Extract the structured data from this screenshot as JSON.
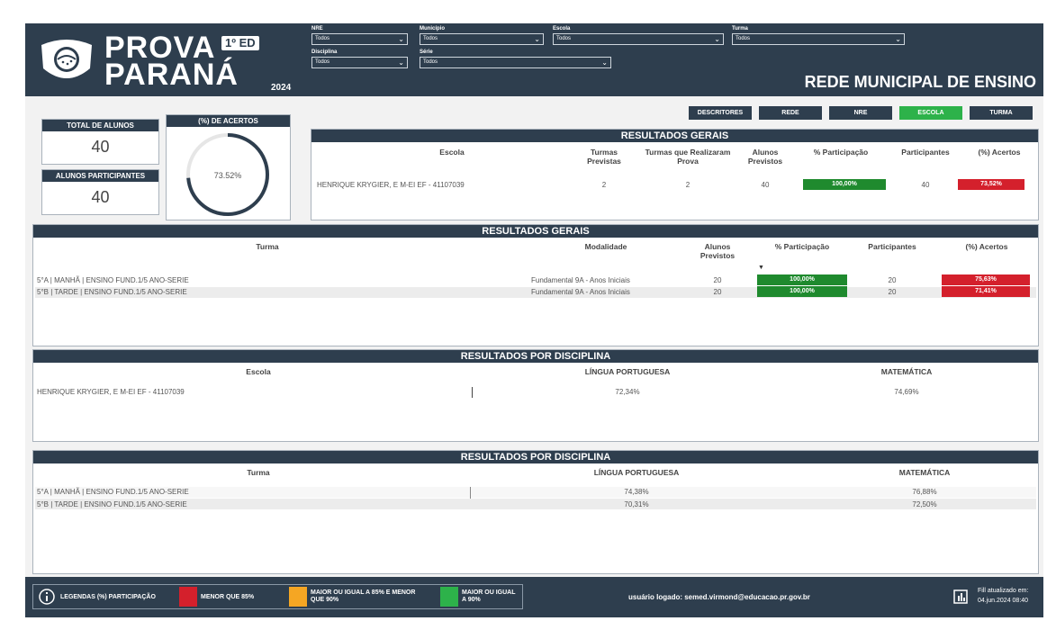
{
  "header": {
    "logo_line1": "PROVA",
    "logo_edition": "1º ED",
    "logo_line2": "PARANÁ",
    "logo_year": "2024",
    "title": "REDE MUNICIPAL DE ENSINO",
    "filters": [
      {
        "label": "NRE",
        "value": "Todos"
      },
      {
        "label": "Município",
        "value": "Todos"
      },
      {
        "label": "Escola",
        "value": "Todos"
      },
      {
        "label": "Turma",
        "value": "Todos"
      },
      {
        "label": "Disciplina",
        "value": "Todos"
      },
      {
        "label": "Série",
        "value": "Todos"
      }
    ]
  },
  "nav": {
    "buttons": [
      "DESCRITORES",
      "REDE",
      "NRE",
      "ESCOLA",
      "TURMA"
    ],
    "active": "ESCOLA"
  },
  "kpis": {
    "total_alunos_label": "TOTAL DE ALUNOS",
    "total_alunos_value": "40",
    "participantes_label": "ALUNOS PARTICIPANTES",
    "participantes_value": "40",
    "acertos_label": "(%) DE ACERTOS",
    "acertos_value": "73.52%",
    "acertos_fraction": 0.7352
  },
  "resultados_escola": {
    "title": "RESULTADOS GERAIS",
    "headers": [
      "Escola",
      "Turmas Previstas",
      "Turmas que Realizaram Prova",
      "Alunos Previstos",
      "% Participação",
      "Participantes",
      "(%) Acertos"
    ],
    "row": {
      "escola": "HENRIQUE KRYGIER, E M-EI EF - 41107039",
      "turmas_previstas": "2",
      "turmas_realizaram": "2",
      "alunos_previstos": "40",
      "participacao": "100,00%",
      "participantes": "40",
      "acertos": "73,52%"
    }
  },
  "resultados_turma": {
    "title": "RESULTADOS GERAIS",
    "headers": [
      "Turma",
      "Modalidade",
      "Alunos Previstos",
      "% Participação",
      "Participantes",
      "(%) Acertos"
    ],
    "rows": [
      {
        "turma": "5°A | MANHÃ | ENSINO FUND.1/5 ANO-SERIE",
        "modalidade": "Fundamental 9A - Anos Iniciais",
        "alunos": "20",
        "participacao": "100,00%",
        "participantes": "20",
        "acertos": "75,63%"
      },
      {
        "turma": "5°B | TARDE | ENSINO FUND.1/5 ANO-SERIE",
        "modalidade": "Fundamental 9A - Anos Iniciais",
        "alunos": "20",
        "participacao": "100,00%",
        "participantes": "20",
        "acertos": "71,41%"
      }
    ]
  },
  "disciplina_escola": {
    "title": "RESULTADOS POR DISCIPLINA",
    "headers": [
      "Escola",
      "LÍNGUA PORTUGUESA",
      "MATEMÁTICA"
    ],
    "row": {
      "escola": "HENRIQUE KRYGIER, E M-EI EF - 41107039",
      "portugues": "72,34%",
      "matematica": "74,69%"
    }
  },
  "disciplina_turma": {
    "title": "RESULTADOS POR DISCIPLINA",
    "headers": [
      "Turma",
      "LÍNGUA PORTUGUESA",
      "MATEMÁTICA"
    ],
    "rows": [
      {
        "turma": "5°A | MANHÃ | ENSINO FUND.1/5 ANO-SERIE",
        "portugues": "74,38%",
        "matematica": "76,88%"
      },
      {
        "turma": "5°B | TARDE | ENSINO FUND.1/5 ANO-SERIE",
        "portugues": "70,31%",
        "matematica": "72,50%"
      }
    ]
  },
  "footer": {
    "legend_label": "LEGENDAS (%) PARTICIPAÇÃO",
    "legend_items": [
      {
        "text": "MENOR QUE 85%",
        "color": "#d4202c"
      },
      {
        "text": "MAIOR OU IGUAL A 85% E MENOR QUE 90%",
        "color": "#f5a623"
      },
      {
        "text": "MAIOR OU IGUAL A 90%",
        "color": "#2db24a"
      }
    ],
    "user": "usuário logado: semed.virmond@educacao.pr.gov.br",
    "updated_label": "Fill atualizado em:",
    "updated_value": "04.jun.2024 08:40"
  },
  "colors": {
    "header": "#2e3e4e",
    "green": "#1f8a2e",
    "red": "#d4202c",
    "orange": "#f5a623"
  }
}
